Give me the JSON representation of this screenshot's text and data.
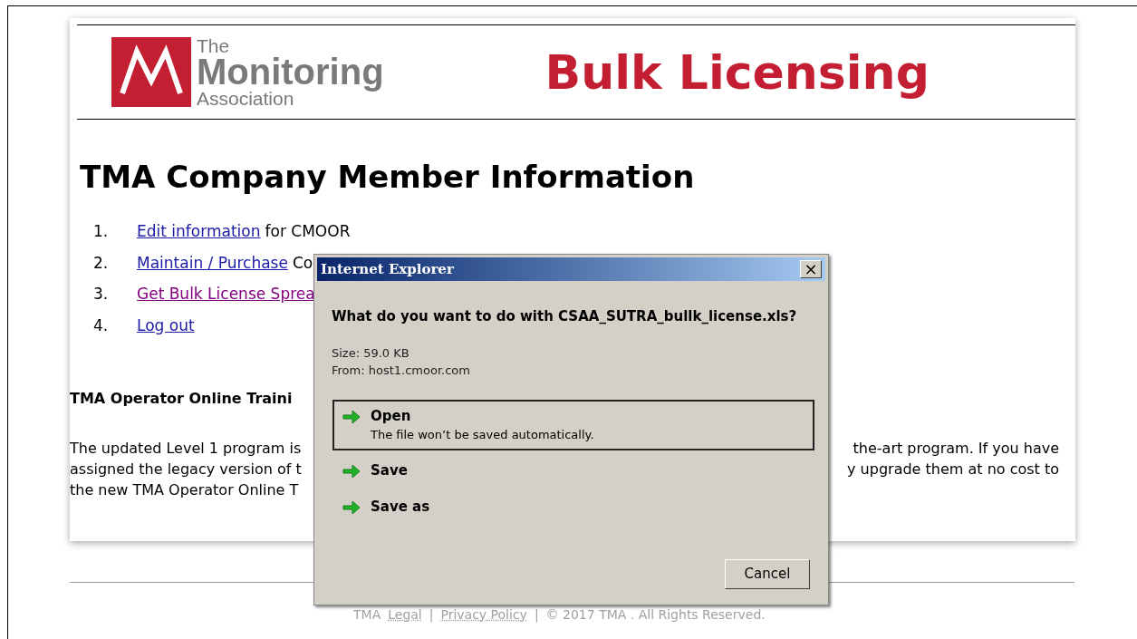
{
  "logo": {
    "line_1": "The",
    "line_2": "Monitoring",
    "line_3": "Association"
  },
  "banner": "Bulk Licensing",
  "heading": "TMA Company Member Information",
  "menu": [
    {
      "number": "1.",
      "link": "Edit information",
      "rest": "for CMOOR",
      "visited": false
    },
    {
      "number": "2.",
      "link": "Maintain / Purchase",
      "rest": "Co",
      "visited": false
    },
    {
      "number": "3.",
      "link": "Get Bulk License Sprea",
      "visited": true
    },
    {
      "number": "4.",
      "link": "Log out",
      "visited": false
    }
  ],
  "section_heading": "TMA Operator Online Traini",
  "paragraph_lines": [
    {
      "left": "The updated Level 1 program is",
      "right": "the-art program. If you have"
    },
    {
      "left": "assigned the legacy version of t",
      "right": "y upgrade them at no cost to"
    },
    {
      "left": "the new TMA Operator Online T"
    }
  ],
  "footer": [
    {
      "kind": "text",
      "text": "TMA"
    },
    {
      "kind": "link",
      "text": "Legal"
    },
    {
      "kind": "text",
      "text": "|"
    },
    {
      "kind": "link",
      "text": "Privacy Policy"
    },
    {
      "kind": "text",
      "text": "|"
    },
    {
      "kind": "text",
      "text": "© 2017 TMA . All Rights Reserved."
    }
  ],
  "dialog": {
    "title": "Internet Explorer",
    "close": "×",
    "question": "What do you want to do with CSAA_SUTRA_bullk_license.xls?",
    "size": "Size: 59.0 KB",
    "from": "From: host1.cmoor.com",
    "options": [
      {
        "label": "Open",
        "description": "The file won’t be saved automatically.",
        "selected": true
      },
      {
        "label": "Save",
        "selected": false
      },
      {
        "label": "Save as",
        "selected": false
      }
    ],
    "cancel": "Cancel"
  }
}
